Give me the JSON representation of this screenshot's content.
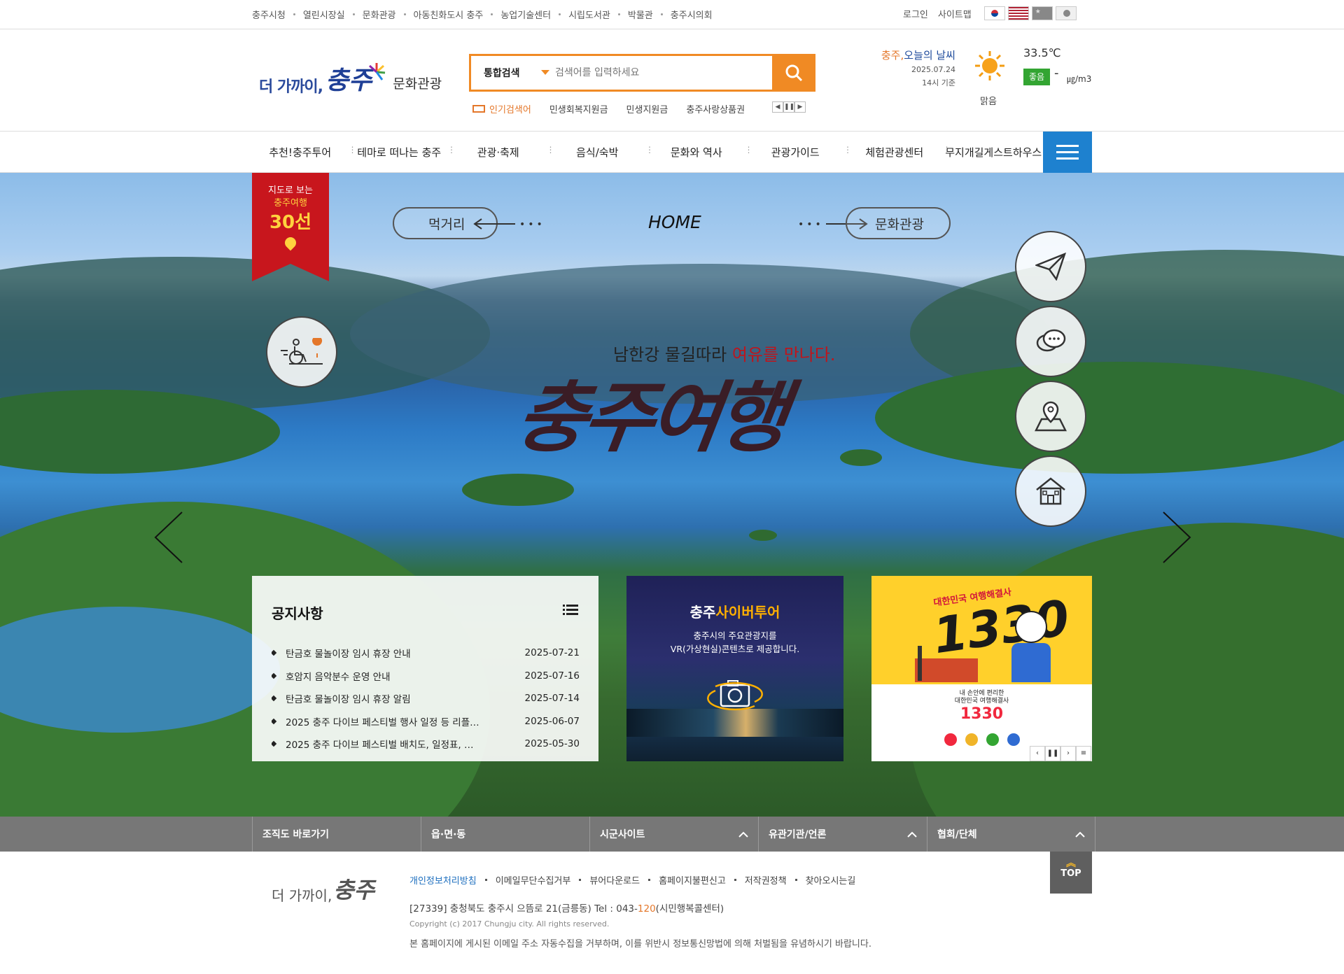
{
  "topbar": {
    "links": [
      "충주시청",
      "열린시장실",
      "문화관광",
      "아동친화도시 충주",
      "농업기술센터",
      "시립도서관",
      "박물관",
      "충주시의회"
    ],
    "login": "로그인",
    "sitemap": "사이트맵",
    "flags": [
      "korean-flag",
      "us-flag",
      "china-flag",
      "japan-flag"
    ]
  },
  "header": {
    "logo_prefix": "더 가까이,",
    "logo_city": "충주",
    "logo_section": "문화관광",
    "search": {
      "select_value": "통합검색",
      "placeholder": "검색어를 입력하세요",
      "button_icon": "search-icon"
    },
    "popular": {
      "label": "인기검색어",
      "words": [
        "민생회복지원금",
        "민생지원금",
        "충주사랑상품권"
      ],
      "controls": [
        "◀",
        "❚❚",
        "▶"
      ]
    },
    "weather": {
      "title_city": "충주,",
      "title_rest": "오늘의 날씨",
      "date": "2025.07.24",
      "base": "14시 기준",
      "icon": "sun-icon",
      "state": "맑음",
      "temp": "33.5℃",
      "air_grade": "좋음",
      "air_value": "-",
      "air_unit": "㎍/m3"
    }
  },
  "gnb": {
    "items": [
      "추천!충주투어",
      "테마로 떠나는 충주",
      "관광·축제",
      "음식/숙박",
      "문화와 역사",
      "관광가이드",
      "체험관광센터",
      "무지개길게스트하우스"
    ],
    "menu_icon": "hamburger-icon"
  },
  "hero": {
    "badge": {
      "line1": "지도로 보는",
      "line2": "충주여행",
      "line3": "30선"
    },
    "prev_label": "먹거리",
    "next_label": "문화관광",
    "home_label": "HOME",
    "slogan_prefix": "남한강 물길따라 ",
    "slogan_highlight": "여유를 만나다.",
    "title": "충주여행",
    "side_icons": [
      "paper-plane-icon",
      "chat-bubbles-icon",
      "map-pin-icon",
      "house-icon"
    ],
    "left_icon": "wheelchair-travel-icon"
  },
  "notice": {
    "title": "공지사항",
    "more_icon": "list-icon",
    "items": [
      {
        "title": "탄금호 물놀이장 임시 휴장 안내",
        "date": "2025-07-21"
      },
      {
        "title": "호암지 음악분수 운영 안내",
        "date": "2025-07-16"
      },
      {
        "title": "탄금호 물놀이장 임시 휴장 알림",
        "date": "2025-07-14"
      },
      {
        "title": "2025 충주 다이브 페스티벌 행사 일정 등 리플…",
        "date": "2025-06-07"
      },
      {
        "title": "2025 충주 다이브 페스티벌 배치도, 일정표, …",
        "date": "2025-05-30"
      }
    ]
  },
  "cyber": {
    "title_prefix": "충주",
    "title_highlight": "사이버투어",
    "desc_line1": "충주시의 주요관광지를",
    "desc_line2": "VR(가상현실)콘텐츠로 제공합니다.",
    "icon": "vr-camera-icon"
  },
  "banner": {
    "top": "대한민국 여행해결사",
    "number": "1330",
    "bottom_line1": "내 손안에 편리한",
    "bottom_line2": "대한민국 여행해결사",
    "bottom_number": "1330",
    "controls": [
      "‹",
      "❚❚",
      "›",
      "≡"
    ]
  },
  "quicklinks": [
    "조직도 바로가기",
    "읍·면·동",
    "시군사이트",
    "유관기관/언론",
    "협회/단체"
  ],
  "footer": {
    "logo_prefix": "더 가까이,",
    "logo_city": "충주",
    "links": [
      "개인정보처리방침",
      "이메일무단수집거부",
      "뷰어다운로드",
      "홈페이지불편신고",
      "저작권정책",
      "찾아오시는길"
    ],
    "address_prefix": "[27339] 충청북도 충주시 으뜸로 21(금릉동) Tel : 043-",
    "address_highlight": "120",
    "address_suffix": "(시민행복콜센터)",
    "copyright": "Copyright (c) 2017 Chungju city. All rights reserved.",
    "notice": "본 홈페이지에 게시된 이메일 주소 자동수집을 거부하며, 이를 위반시 정보통신망법에 의해 처벌됨을 유념하시기 바랍니다.",
    "top_label": "TOP"
  },
  "colors": {
    "accent_orange": "#f08a24",
    "brand_blue": "#1f3f96",
    "menu_blue": "#1e81cf",
    "badge_red": "#c8161d",
    "air_good": "#33a532"
  }
}
